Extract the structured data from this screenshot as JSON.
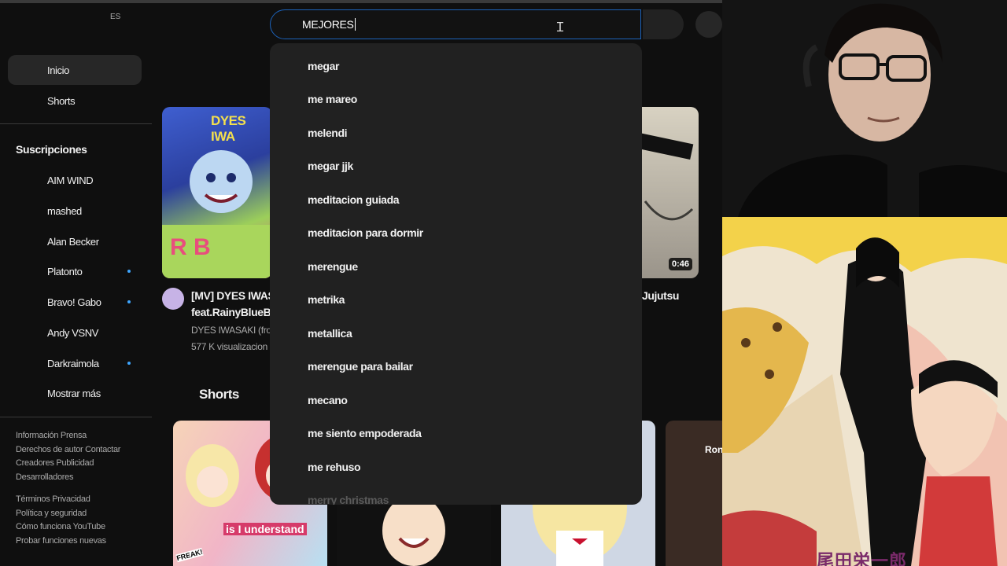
{
  "header": {
    "region": "ES",
    "search_value": "MEJORES"
  },
  "suggestions": [
    "megar",
    "me mareo",
    "melendi",
    "megar jjk",
    "meditacion guiada",
    "meditacion para dormir",
    "merengue",
    "metrika",
    "metallica",
    "merengue para bailar",
    "mecano",
    "me siento empoderada",
    "me rehuso",
    "merry christmas"
  ],
  "sidebar": {
    "main": [
      {
        "label": "Inicio"
      },
      {
        "label": "Shorts"
      }
    ],
    "subscriptions_title": "Suscripciones",
    "subscriptions": [
      {
        "label": "AIM WIND",
        "new": false
      },
      {
        "label": "mashed",
        "new": false
      },
      {
        "label": "Alan Becker",
        "new": false
      },
      {
        "label": "Platonto",
        "new": true
      },
      {
        "label": "Bravo! Gabo",
        "new": true
      },
      {
        "label": "Andy VSNV",
        "new": false
      },
      {
        "label": "Darkraimola",
        "new": true
      },
      {
        "label": "Mostrar más",
        "new": false
      }
    ],
    "footer": [
      "Información  Prensa",
      "Derechos de autor  Contactar",
      "Creadores  Publicidad",
      "Desarrolladores",
      "Términos  Privacidad",
      "Política y seguridad",
      "Cómo funciona YouTube",
      "Probar funciones nuevas"
    ]
  },
  "videos": [
    {
      "title_line1": "[MV] DYES IWAS",
      "title_line2": "feat.RainyBlueBe",
      "channel": "DYES IWASAKI (fro",
      "views": "577 K visualizacion",
      "thumb_text1": "DYES IWA",
      "thumb_text2": "R  B"
    },
    {
      "title_line1": "Jujutsu",
      "duration": "0:46"
    }
  ],
  "shorts_title": "Shorts",
  "shorts": [
    {
      "caption": "is I understand",
      "sticker": "FREAK!"
    },
    {
      "caption": ""
    },
    {
      "caption": ""
    },
    {
      "caption": "Ron"
    }
  ],
  "manga": {
    "author_text": "尾田栄一郎"
  },
  "colors": {
    "background": "#0f0f0f",
    "dropdown": "#212121",
    "search_border": "#1c62b9",
    "new_dot": "#3ea6ff"
  }
}
